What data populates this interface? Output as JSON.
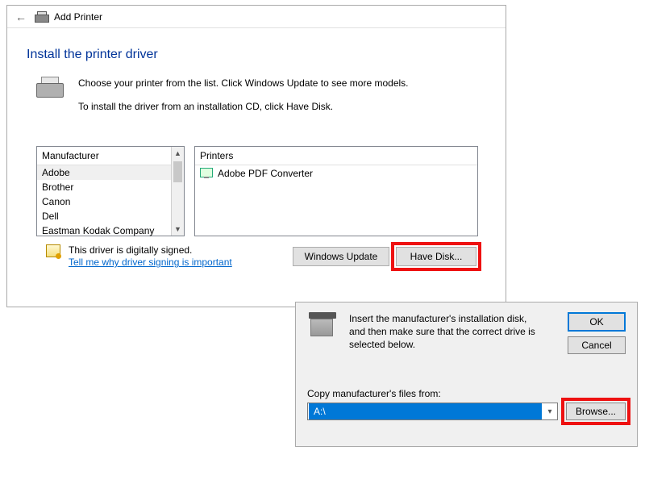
{
  "wizard": {
    "title": "Add Printer",
    "page_title": "Install the printer driver",
    "instruction1": "Choose your printer from the list. Click Windows Update to see more models.",
    "instruction2": "To install the driver from an installation CD, click Have Disk.",
    "mfr_header": "Manufacturer",
    "printers_header": "Printers",
    "manufacturers": [
      "Adobe",
      "Brother",
      "Canon",
      "Dell",
      "Eastman Kodak Company"
    ],
    "selected_mfr_index": 0,
    "printers": [
      "Adobe PDF Converter"
    ],
    "signed_text": "This driver is digitally signed.",
    "help_link": "Tell me why driver signing is important",
    "btn_windows_update": "Windows Update",
    "btn_have_disk": "Have Disk..."
  },
  "disk": {
    "message": "Insert the manufacturer's installation disk, and then make sure that the correct drive is selected below.",
    "ok": "OK",
    "cancel": "Cancel",
    "copy_label": "Copy manufacturer's files from:",
    "path_value": "A:\\",
    "browse": "Browse..."
  }
}
